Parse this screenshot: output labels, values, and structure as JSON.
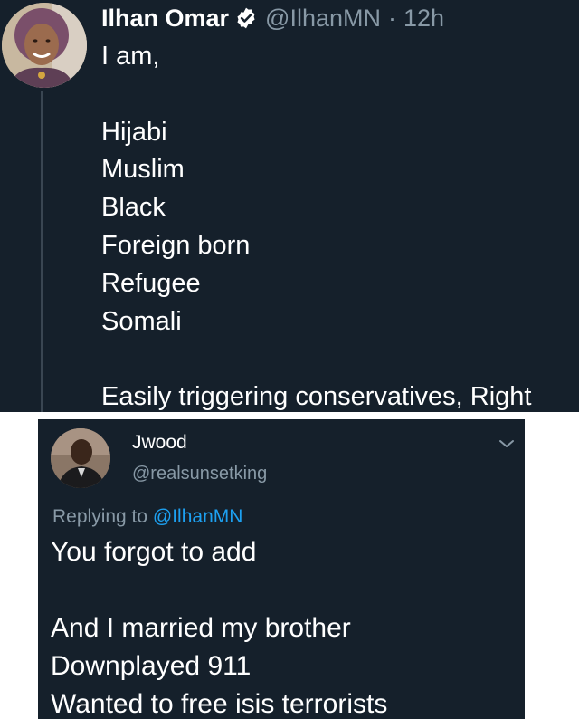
{
  "main_tweet": {
    "display_name": "Ilhan Omar",
    "handle": "@IlhanMN",
    "separator": "·",
    "time": "12h",
    "verified": true,
    "avatar_icon": "user-avatar-photo",
    "lines": [
      "I am,",
      "",
      "Hijabi",
      "Muslim",
      "Black",
      "Foreign born",
      "Refugee",
      "Somali",
      "",
      "Easily triggering conservatives, Right"
    ]
  },
  "reply_tweet": {
    "display_name": "Jwood",
    "handle": "@realsunsetking",
    "replying_prefix": "Replying to",
    "replying_to": "@IlhanMN",
    "avatar_icon": "user-avatar-photo",
    "menu_icon": "chevron-down-icon",
    "lines": [
      "You forgot to add",
      "",
      "And I married my brother",
      "Downplayed 911",
      "Wanted to free isis terrorists"
    ]
  },
  "colors": {
    "background_dark": "#15202b",
    "secondary_text": "#8899a6",
    "link": "#1da1f2",
    "verified_badge": "#ffffff"
  }
}
